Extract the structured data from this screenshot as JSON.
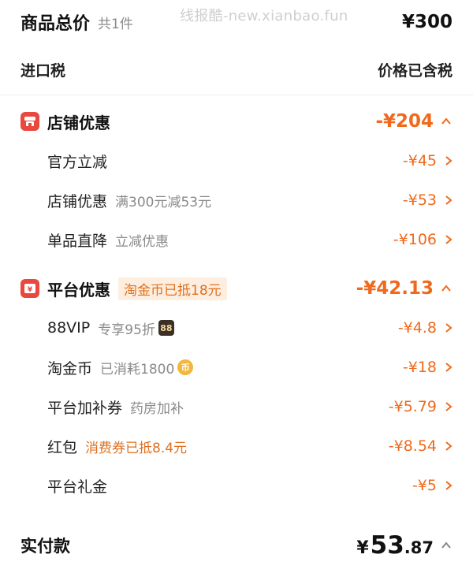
{
  "watermark": "线报酷-new.xianbao.fun",
  "header": {
    "title": "商品总价",
    "count": "共1件",
    "total": "¥300"
  },
  "tax": {
    "label": "进口税",
    "value": "价格已含税"
  },
  "shop_group": {
    "name": "店铺优惠",
    "amount": "-¥204",
    "icon": "shop-icon",
    "items": [
      {
        "name": "官方立减",
        "sub": "",
        "amount": "-¥45"
      },
      {
        "name": "店铺优惠",
        "sub": "满300元减53元",
        "amount": "-¥53"
      },
      {
        "name": "单品直降",
        "sub": "立减优惠",
        "amount": "-¥106"
      }
    ]
  },
  "platform_group": {
    "name": "平台优惠",
    "tag": "淘金币已抵18元",
    "amount": "-¥42.13",
    "icon": "coupon-icon",
    "items": [
      {
        "name": "88VIP",
        "sub": "专享95折",
        "badge": "88",
        "amount": "-¥4.8"
      },
      {
        "name": "淘金币",
        "sub": "已消耗1800",
        "coin": "币",
        "amount": "-¥18"
      },
      {
        "name": "平台加补券",
        "sub": "药房加补",
        "amount": "-¥5.79"
      },
      {
        "name": "红包",
        "sub": "消费券已抵8.4元",
        "amount": "-¥8.54"
      },
      {
        "name": "平台礼金",
        "sub": "",
        "amount": "-¥5"
      }
    ]
  },
  "payment": {
    "label": "实付款",
    "yen": "¥",
    "int": "53",
    "dec": ".87"
  },
  "colors": {
    "accent": "#ef6a1c",
    "icon_red": "#e9483f",
    "tag_bg": "#fdeedf"
  }
}
